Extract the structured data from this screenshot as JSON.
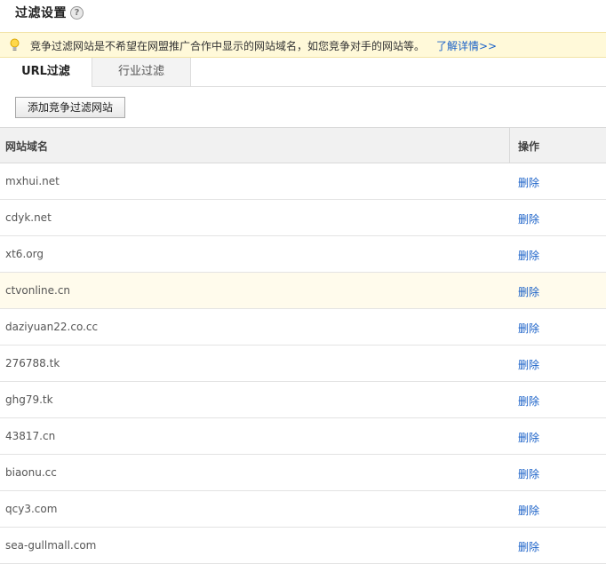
{
  "header": {
    "title": "过滤设置",
    "help_icon": "?"
  },
  "notice": {
    "text": "竞争过滤网站是不希望在网盟推广合作中显示的网站域名，如您竞争对手的网站等。",
    "link": "了解详情>>",
    "icon": "lightbulb-icon"
  },
  "tabs": [
    {
      "label": "URL过滤",
      "active": true
    },
    {
      "label": "行业过滤",
      "active": false
    }
  ],
  "toolbar": {
    "add_label": "添加竞争过滤网站"
  },
  "table": {
    "headers": {
      "domain": "网站域名",
      "action": "操作"
    },
    "rows": [
      {
        "domain": "mxhui.net",
        "action": "删除"
      },
      {
        "domain": "cdyk.net",
        "action": "删除"
      },
      {
        "domain": "xt6.org",
        "action": "删除"
      },
      {
        "domain": "ctvonline.cn",
        "action": "删除",
        "highlight": true
      },
      {
        "domain": "daziyuan22.co.cc",
        "action": "删除"
      },
      {
        "domain": "276788.tk",
        "action": "删除"
      },
      {
        "domain": "ghg79.tk",
        "action": "删除"
      },
      {
        "domain": "43817.cn",
        "action": "删除"
      },
      {
        "domain": "biaonu.cc",
        "action": "删除"
      },
      {
        "domain": "qcy3.com",
        "action": "删除"
      },
      {
        "domain": "sea-gullmall.com",
        "action": "删除"
      }
    ]
  },
  "colors": {
    "link": "#1a61c8",
    "notice_bg": "#fff9d9",
    "highlight_row": "#fffbec"
  }
}
